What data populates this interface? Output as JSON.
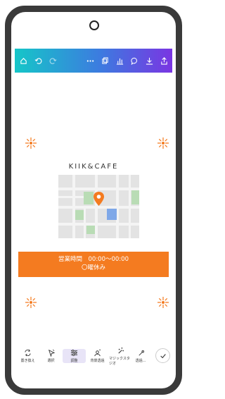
{
  "toolbar": {
    "left_icons": [
      "home-icon",
      "undo-icon",
      "redo-icon"
    ],
    "right_icons": [
      "more-icon",
      "layers-icon",
      "chart-icon",
      "comment-icon",
      "download-icon",
      "share-icon"
    ]
  },
  "design": {
    "title": "KIIK&CAFE",
    "banner_line1": "営業時間　00:00～00:00",
    "banner_line2": "〇曜休み",
    "accent_color": "#f47b20"
  },
  "bottom_tools": [
    {
      "label": "置き換え",
      "icon": "replace-icon"
    },
    {
      "label": "選択",
      "icon": "select-icon"
    },
    {
      "label": "調整",
      "icon": "adjust-icon",
      "active": true
    },
    {
      "label": "背景透過",
      "icon": "bg-remove-icon"
    },
    {
      "label": "マジックスタジオ",
      "icon": "magic-studio-icon"
    },
    {
      "label": "透過...",
      "icon": "transparency-icon"
    }
  ],
  "confirm_icon": "check-icon"
}
